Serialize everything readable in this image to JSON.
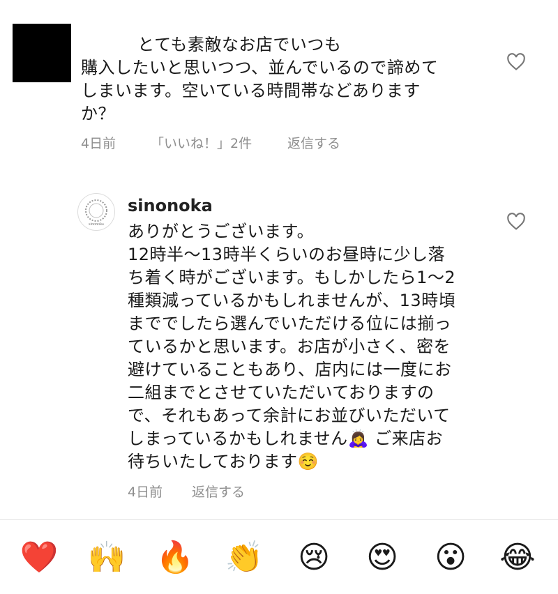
{
  "comments": [
    {
      "avatar": "redacted-avatar",
      "lines": [
        "          とても素敵なお店でいつも",
        "購入したいと思いつつ、並んでいるので諦めて",
        "しまいます。空いている時間帯などあります",
        "か？"
      ],
      "time": "4日前",
      "likes": "「いいね！」2件",
      "reply_label": "返信する",
      "like_icon": "heart-outline-icon"
    },
    {
      "username": "sinonoka",
      "avatar_text": "sinonoka",
      "lines": [
        "ありがとうございます。",
        "12時半〜13時半くらいのお昼時に少し落",
        "ち着く時がございます。もしかしたら1〜2",
        "種類減っているかもしれませんが、13時頃",
        "まででしたら選んでいただける位には揃っ",
        "ているかと思います。お店が小さく、密を",
        "避けていることもあり、店内には一度にお",
        "二組までとさせていただいておりますの",
        "で、それもあって余計にお並びいただいて",
        "しまっているかもしれません🙇‍♀️ ご来店お",
        "待ちいたしております☺️"
      ],
      "time": "4日前",
      "reply_label": "返信する",
      "like_icon": "heart-outline-icon"
    }
  ],
  "emoji_bar": [
    "❤️",
    "🙌",
    "🔥",
    "👏",
    "😢",
    "😍",
    "😮",
    "😂"
  ]
}
